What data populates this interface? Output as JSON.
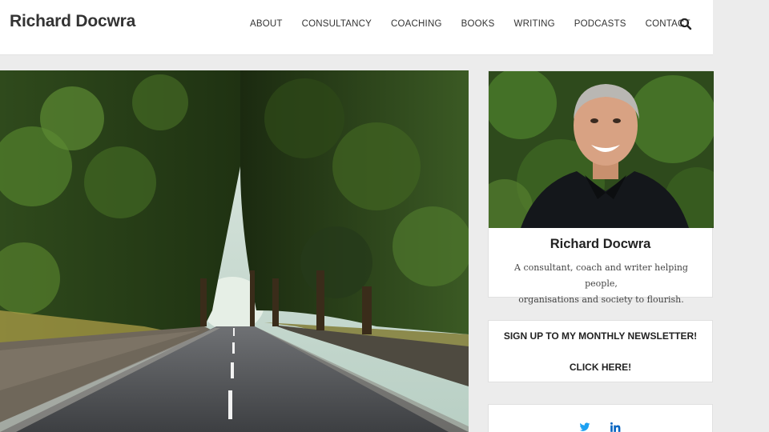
{
  "header": {
    "site_title": "Richard Docwra",
    "nav": [
      "ABOUT",
      "CONSULTANCY",
      "COACHING",
      "BOOKS",
      "WRITING",
      "PODCASTS",
      "CONTACT"
    ]
  },
  "icons": {
    "search": "search-icon",
    "twitter": "twitter-icon",
    "linkedin": "linkedin-icon"
  },
  "sidebar": {
    "profile": {
      "name": "Richard Docwra",
      "bio_line1": "A consultant, coach and writer helping people,",
      "bio_line2": "organisations and society to flourish."
    },
    "newsletter": {
      "title": "SIGN UP TO MY MONTHLY NEWSLETTER!",
      "cta": "CLICK HERE!"
    }
  },
  "colors": {
    "page_bg": "#ececec",
    "card_bg": "#ffffff",
    "twitter": "#1da1f2",
    "linkedin": "#0a66c2"
  }
}
